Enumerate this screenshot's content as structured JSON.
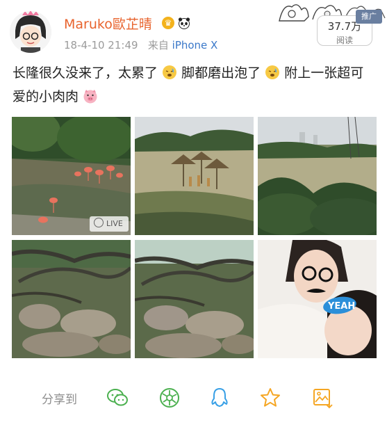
{
  "user": {
    "name": "Maruko歐芷晴",
    "crown_glyph": "♛"
  },
  "meta": {
    "time": "18-4-10 21:49",
    "from_label": "来自",
    "source": "iPhone X"
  },
  "stats": {
    "reads": "37.7万",
    "reads_label": "阅读",
    "promo_label": "推广"
  },
  "post": {
    "seg1": "长隆很久没来了，太累了",
    "seg2": "脚都磨出泡了",
    "seg3": "附上一张超可爱的小肉肉",
    "emoji": [
      "tired-face-icon",
      "tired-face-icon",
      "pig-face-icon"
    ]
  },
  "photos": [
    {
      "id": "flamingo",
      "live_label": "LIVE"
    },
    {
      "id": "savanna"
    },
    {
      "id": "forest"
    },
    {
      "id": "trees-1"
    },
    {
      "id": "trees-2"
    },
    {
      "id": "selfie",
      "sticker_text": "YEAH"
    }
  ],
  "share": {
    "label": "分享到",
    "icons": [
      "wechat-icon",
      "moments-icon",
      "qq-icon",
      "favorite-star-icon",
      "save-image-icon"
    ]
  },
  "colors": {
    "username": "#e8632d",
    "link": "#3a78c9",
    "share_accent": "#f5a623",
    "wechat": "#4bb04f",
    "qq": "#39a0e6"
  }
}
